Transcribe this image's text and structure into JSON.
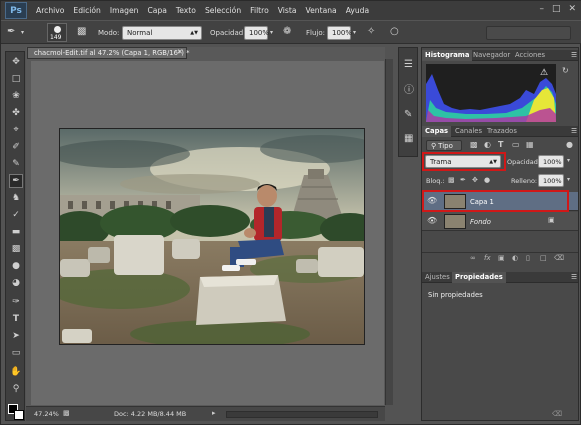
{
  "app": {
    "logo": "Ps"
  },
  "menu": [
    "Archivo",
    "Edición",
    "Imagen",
    "Capa",
    "Texto",
    "Selección",
    "Filtro",
    "Vista",
    "Ventana",
    "Ayuda"
  ],
  "options": {
    "brush_size": "149",
    "mode_label": "Modo:",
    "mode_value": "Normal",
    "opacity_label": "Opacidad:",
    "opacity_value": "100%",
    "flow_label": "Flujo:",
    "flow_value": "100%"
  },
  "document": {
    "tab_title": "chacmol-Edit.tif al 47.2% (Capa 1, RGB/16*) *",
    "zoom": "47.24%",
    "doc_info": "Doc: 4.22 MB/8.44 MB"
  },
  "panels": {
    "top_tabs": [
      "Histograma",
      "Navegador",
      "Acciones"
    ],
    "layer_tabs": [
      "Capas",
      "Canales",
      "Trazados"
    ],
    "filter_kind": "Tipo",
    "blend_mode": "Trama",
    "opacity_label": "Opacidad:",
    "opacity_value": "100%",
    "lock_label": "Bloq.:",
    "fill_label": "Relleno:",
    "fill_value": "100%",
    "layers": [
      {
        "name": "Capa 1",
        "selected": true
      },
      {
        "name": "Fondo",
        "selected": false,
        "locked": true
      }
    ],
    "bottom_tabs": [
      "Ajustes",
      "Propiedades"
    ],
    "properties_text": "Sin propiedades"
  },
  "colors": {
    "highlight": "#d01818",
    "selected_layer": "#5f6e84"
  }
}
